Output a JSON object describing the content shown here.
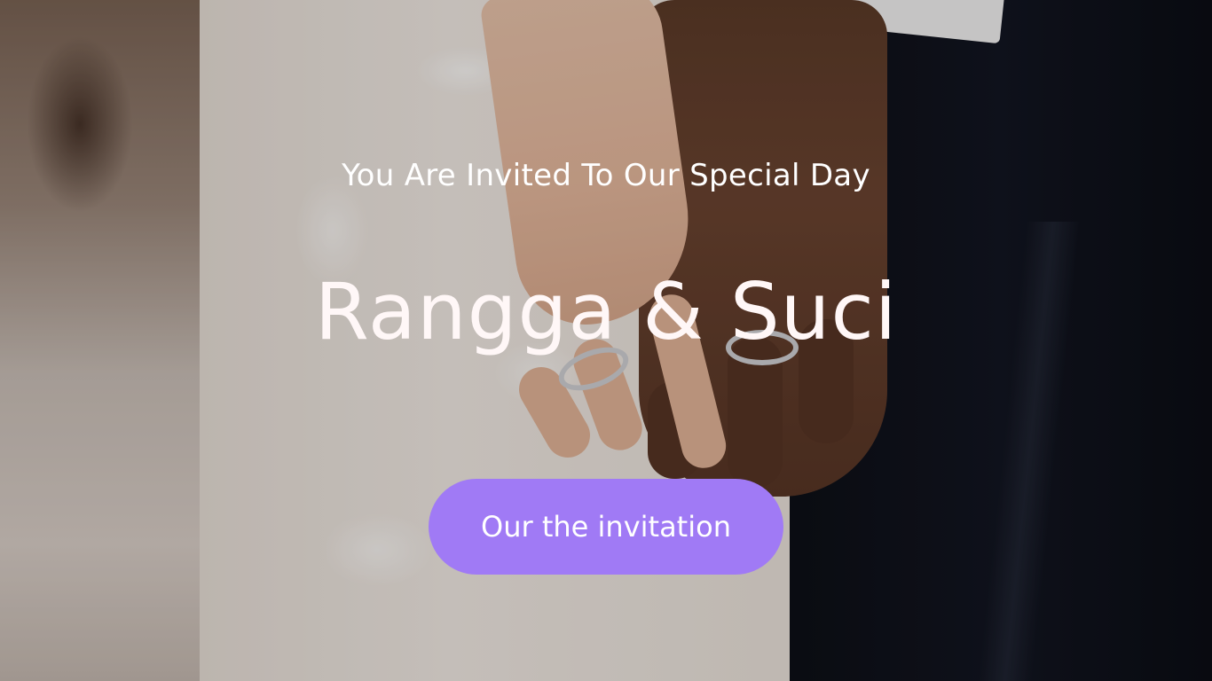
{
  "hero": {
    "subtitle": "You Are Invited To Our Special Day",
    "names": "Rangga & Suci",
    "cta_label": "Our the invitation"
  },
  "colors": {
    "button": "#a07af5",
    "text": "#ffffff"
  }
}
